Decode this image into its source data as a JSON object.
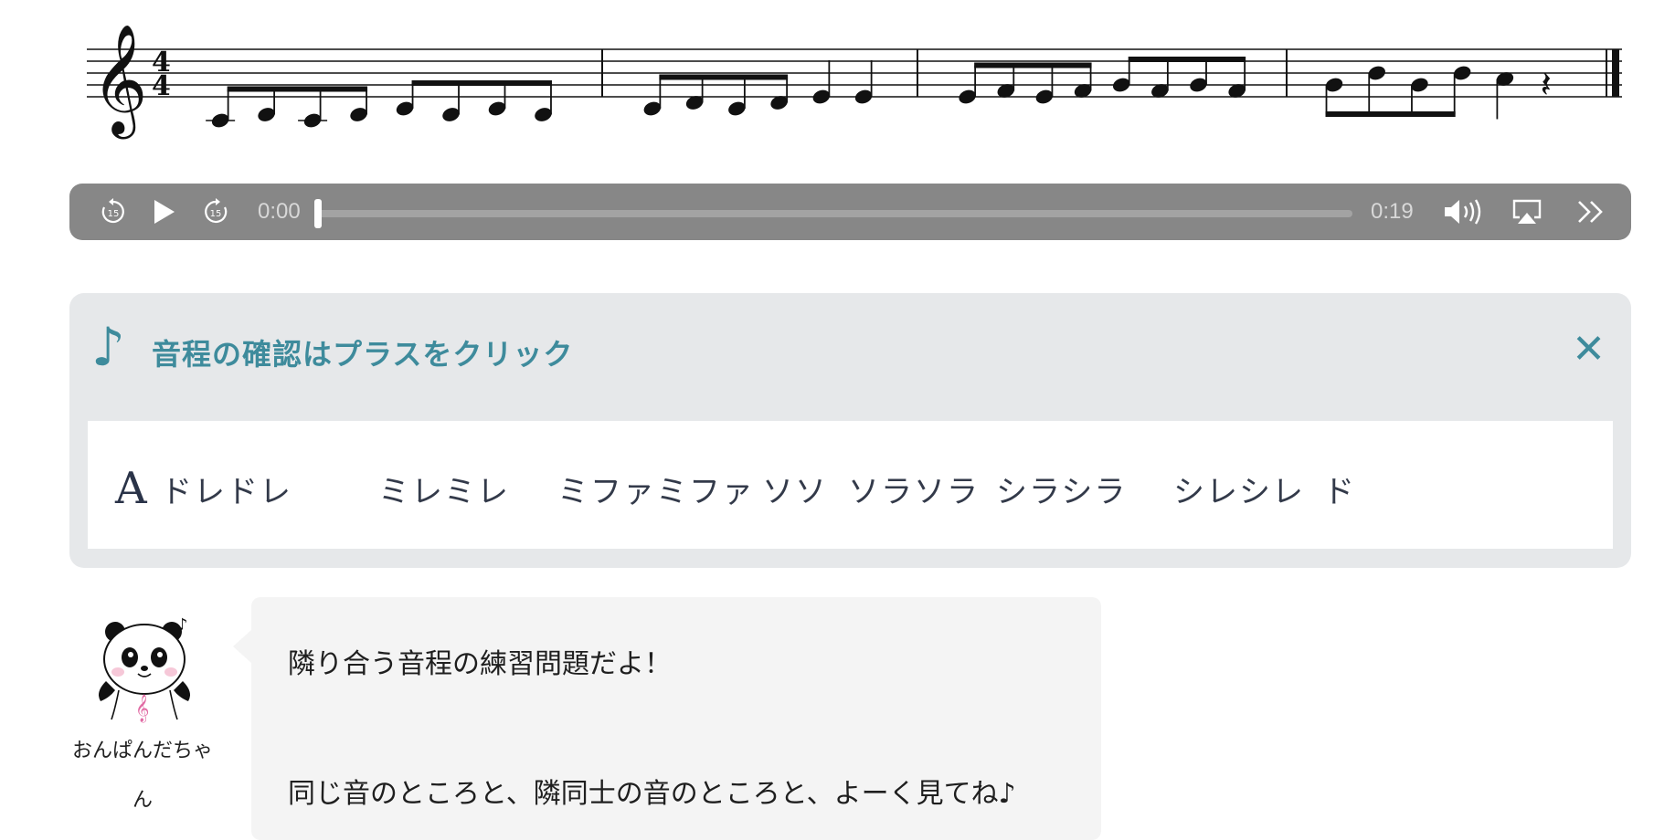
{
  "player": {
    "current_time": "0:00",
    "duration": "0:19",
    "progress": 0,
    "buttons": [
      "rewind-15-icon",
      "play-icon",
      "forward-15-icon",
      "volume-icon",
      "airplay-icon",
      "more-icon"
    ],
    "skip_label": "15"
  },
  "accordion": {
    "note_glyph": "♪",
    "title": "音程の確認はプラスをクリック",
    "close_glyph": "✕",
    "answer_letter": "A",
    "answers": [
      "ドレドレ",
      "ミレミレ",
      "ミファミファ",
      "ソソ",
      "ソラソラ",
      "シラシラ",
      "シレシレ",
      "ド"
    ]
  },
  "character": {
    "name_line1": "おんぱんだちゃ",
    "name_line2": "ん"
  },
  "bubble": {
    "line1": "隣り合う音程の練習問題だよ！",
    "line2": "同じ音のところと、隣同士の音のところと、よーく見てね♪"
  },
  "score": {
    "time_signature": [
      "4",
      "4"
    ],
    "measures": [
      [
        "C4",
        "D4",
        "C4",
        "D4",
        "E4",
        "D4",
        "E4",
        "D4"
      ],
      [
        "E4",
        "F4",
        "E4",
        "F4",
        "G4",
        "G4"
      ],
      [
        "G4",
        "A4",
        "G4",
        "A4",
        "B4",
        "A4",
        "B4",
        "A4"
      ],
      [
        "B4",
        "D5",
        "B4",
        "D5",
        "C5",
        "rest"
      ]
    ]
  }
}
